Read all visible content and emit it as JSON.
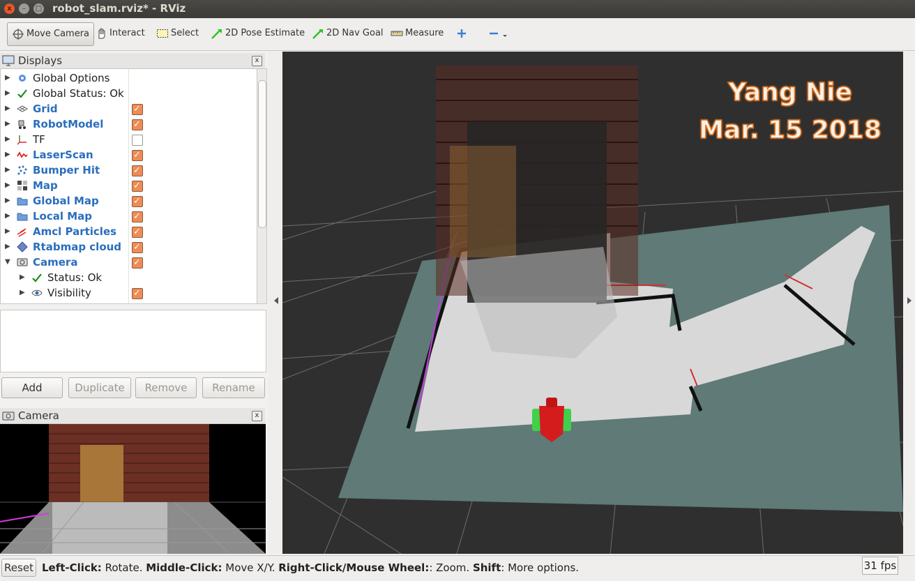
{
  "window": {
    "title": "robot_slam.rviz* - RViz",
    "close": "x",
    "minimize": "–",
    "maximize": "□"
  },
  "toolbar": {
    "move_camera": "Move Camera",
    "interact": "Interact",
    "select": "Select",
    "pose_estimate": "2D Pose Estimate",
    "nav_goal": "2D Nav Goal",
    "measure": "Measure"
  },
  "displays": {
    "title": "Displays",
    "close": "x",
    "items": [
      {
        "label": "Global Options",
        "checked": null,
        "icon": "gear-icon"
      },
      {
        "label": "Global Status: Ok",
        "checked": null,
        "icon": "check-icon"
      },
      {
        "label": "Grid",
        "checked": true,
        "icon": "grid-icon"
      },
      {
        "label": "RobotModel",
        "checked": true,
        "icon": "robot-icon"
      },
      {
        "label": "TF",
        "checked": false,
        "icon": "axes-icon"
      },
      {
        "label": "LaserScan",
        "checked": true,
        "icon": "laser-icon"
      },
      {
        "label": "Bumper Hit",
        "checked": true,
        "icon": "points-icon"
      },
      {
        "label": "Map",
        "checked": true,
        "icon": "map-icon"
      },
      {
        "label": "Global Map",
        "checked": true,
        "icon": "folder-icon"
      },
      {
        "label": "Local Map",
        "checked": true,
        "icon": "folder-icon"
      },
      {
        "label": "Amcl Particles",
        "checked": true,
        "icon": "arrows-icon"
      },
      {
        "label": "Rtabmap cloud",
        "checked": true,
        "icon": "cloud-icon"
      },
      {
        "label": "Camera",
        "checked": true,
        "icon": "camera-icon"
      },
      {
        "label": "Status: Ok",
        "checked": null,
        "icon": "check-icon"
      },
      {
        "label": "Visibility",
        "checked": true,
        "icon": "eye-icon"
      }
    ],
    "buttons": {
      "add": "Add",
      "duplicate": "Duplicate",
      "remove": "Remove",
      "rename": "Rename"
    }
  },
  "camera_panel": {
    "title": "Camera",
    "close": "x"
  },
  "overlay": {
    "line1": "Yang Nie",
    "line2": "Mar. 15 2018"
  },
  "status": {
    "reset": "Reset",
    "k1": "Left-Click:",
    "v1": " Rotate. ",
    "k2": "Middle-Click:",
    "v2": " Move X/Y. ",
    "k3": "Right-Click/Mouse Wheel:",
    "v3": ": Zoom. ",
    "k4": "Shift",
    "v4": ": More options.",
    "fps": "31 fps"
  },
  "colors": {
    "accent_check": "#ef8b55",
    "blue_label": "#2a6ebd",
    "title_bar": "#3b3a36",
    "overlay_stroke": "#e2731f"
  }
}
